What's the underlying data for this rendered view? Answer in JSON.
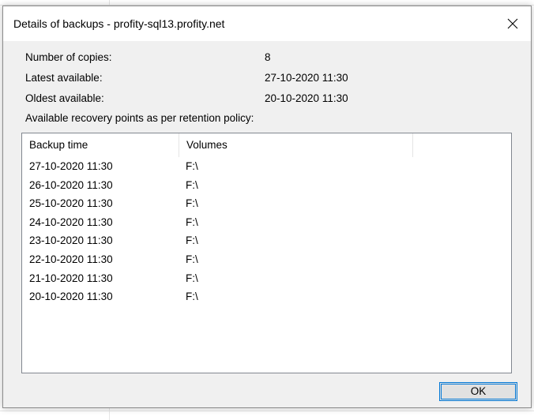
{
  "window": {
    "title": "Details of backups - profity-sql13.profity.net",
    "close_icon": "close-icon"
  },
  "info": {
    "copies_label": "Number of copies:",
    "copies_value": "8",
    "latest_label": "Latest available:",
    "latest_value": "27-10-2020 11:30",
    "oldest_label": "Oldest available:",
    "oldest_value": "20-10-2020 11:30",
    "recovery_label": "Available recovery points as per retention policy:"
  },
  "table": {
    "columns": [
      "Backup time",
      "Volumes"
    ],
    "rows": [
      {
        "time": "27-10-2020 11:30",
        "volume": "F:\\"
      },
      {
        "time": "26-10-2020 11:30",
        "volume": "F:\\"
      },
      {
        "time": "25-10-2020 11:30",
        "volume": "F:\\"
      },
      {
        "time": "24-10-2020 11:30",
        "volume": "F:\\"
      },
      {
        "time": "23-10-2020 11:30",
        "volume": "F:\\"
      },
      {
        "time": "22-10-2020 11:30",
        "volume": "F:\\"
      },
      {
        "time": "21-10-2020 11:30",
        "volume": "F:\\"
      },
      {
        "time": "20-10-2020 11:30",
        "volume": "F:\\"
      }
    ]
  },
  "buttons": {
    "ok_label": "OK"
  },
  "colors": {
    "dialog_bg": "#f0f0f0",
    "focus_border": "#0078d7",
    "list_border": "#828790"
  }
}
